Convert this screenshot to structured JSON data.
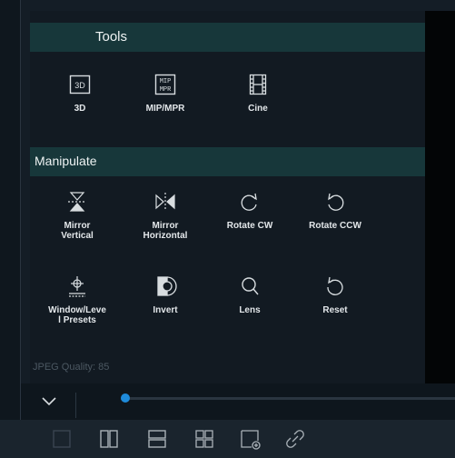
{
  "panel": {
    "tools_header": "Tools",
    "manipulate_header": "Manipulate",
    "tools": [
      {
        "label": "3D",
        "icon": "3d-icon"
      },
      {
        "label": "MIP/MPR",
        "icon": "mip-mpr-icon",
        "badge_top": "MIP",
        "badge_bottom": "MPR"
      },
      {
        "label": "Cine",
        "icon": "film-icon"
      }
    ],
    "manipulate": [
      {
        "label_1": "Mirror",
        "label_2": "Vertical",
        "icon": "mirror-vertical-icon"
      },
      {
        "label_1": "Mirror",
        "label_2": "Horizontal",
        "icon": "mirror-horizontal-icon"
      },
      {
        "label_1": "Rotate CW",
        "label_2": "",
        "icon": "rotate-cw-icon"
      },
      {
        "label_1": "Rotate CCW",
        "label_2": "",
        "icon": "rotate-ccw-icon"
      },
      {
        "label_1": "Window/Leve",
        "label_2": "l Presets",
        "icon": "window-level-icon"
      },
      {
        "label_1": "Invert",
        "label_2": "",
        "icon": "invert-icon"
      },
      {
        "label_1": "Lens",
        "label_2": "",
        "icon": "lens-icon"
      },
      {
        "label_1": "Reset",
        "label_2": "",
        "icon": "reset-icon"
      }
    ],
    "tool_3d_badge": "3D",
    "quality_text": "JPEG Quality: 85"
  },
  "scrubber": {
    "position": 0.01
  },
  "colors": {
    "accent": "#1e8bdb",
    "section_header": "#17373a",
    "panel_bg": "#121a22"
  },
  "layout_buttons": [
    "single-pane-icon",
    "two-column-icon",
    "two-row-icon",
    "grid-2x2-icon",
    "add-pane-icon",
    "link-icon"
  ]
}
